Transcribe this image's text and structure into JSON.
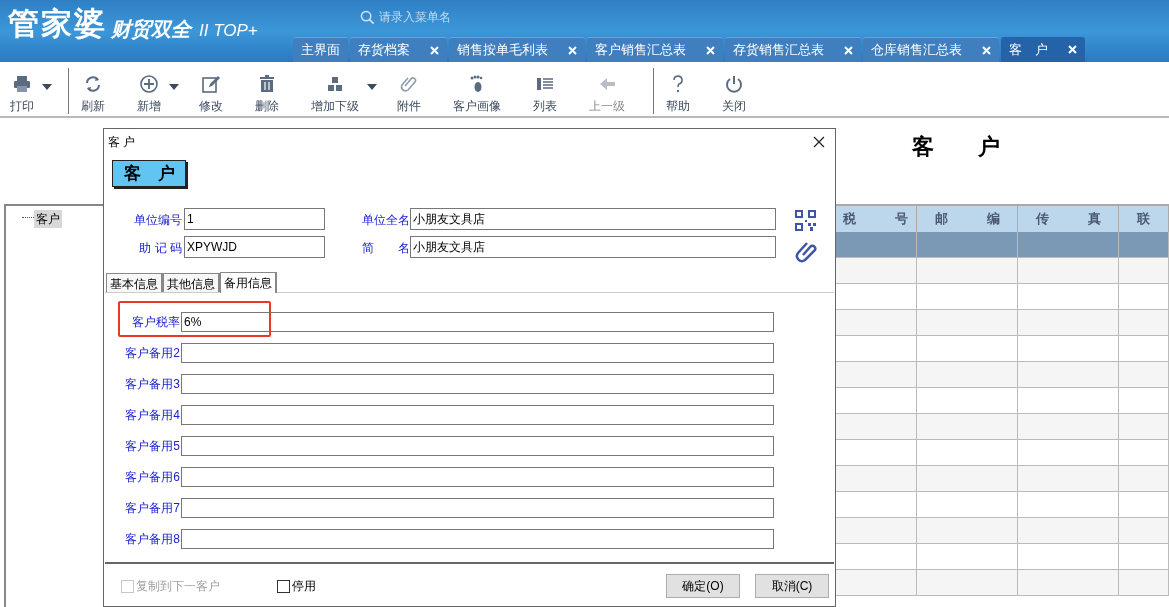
{
  "header": {
    "logo": "管家婆",
    "subtitle": "财贸双全",
    "edition": "II TOP+",
    "search": {
      "placeholder": "请录入菜单名"
    }
  },
  "tabs": [
    {
      "label": "主界面",
      "closable": false,
      "selected": false
    },
    {
      "label": "存货档案",
      "closable": true,
      "selected": false
    },
    {
      "label": "销售按单毛利表",
      "closable": true,
      "selected": false
    },
    {
      "label": "客户销售汇总表",
      "closable": true,
      "selected": false
    },
    {
      "label": "存货销售汇总表",
      "closable": true,
      "selected": false
    },
    {
      "label": "仓库销售汇总表",
      "closable": true,
      "selected": false
    },
    {
      "label": "客　户",
      "closable": true,
      "selected": true
    }
  ],
  "toolbar": [
    {
      "kind": "printer",
      "label": "打印",
      "dropdown": true,
      "disabled": false,
      "separator_after": true
    },
    {
      "kind": "refresh",
      "label": "刷新",
      "dropdown": false,
      "disabled": false,
      "separator_after": false
    },
    {
      "kind": "add",
      "label": "新增",
      "dropdown": true,
      "disabled": false,
      "separator_after": false
    },
    {
      "kind": "edit",
      "label": "修改",
      "dropdown": false,
      "disabled": false,
      "separator_after": false
    },
    {
      "kind": "delete",
      "label": "删除",
      "dropdown": false,
      "disabled": false,
      "separator_after": false
    },
    {
      "kind": "blocks",
      "label": "增加下级",
      "dropdown": true,
      "disabled": false,
      "separator_after": false
    },
    {
      "kind": "clip",
      "label": "附件",
      "dropdown": false,
      "disabled": false,
      "separator_after": false
    },
    {
      "kind": "foot",
      "label": "客户画像",
      "dropdown": false,
      "disabled": false,
      "separator_after": false
    },
    {
      "kind": "list",
      "label": "列表",
      "dropdown": false,
      "disabled": false,
      "separator_after": false
    },
    {
      "kind": "back",
      "label": "上一级",
      "dropdown": false,
      "disabled": true,
      "separator_after": true
    },
    {
      "kind": "help",
      "label": "帮助",
      "dropdown": false,
      "disabled": false,
      "separator_after": false
    },
    {
      "kind": "power",
      "label": "关闭",
      "dropdown": false,
      "disabled": false,
      "separator_after": false
    }
  ],
  "page_title": "客　　户",
  "tree": {
    "items": [
      {
        "label": "客户",
        "selected": true
      }
    ]
  },
  "grid": {
    "columns": [
      "税　　　号",
      "邮　　　编",
      "传　　　真",
      "联"
    ]
  },
  "dialog": {
    "title": "客 户",
    "banner": "客　户",
    "fields": [
      {
        "label": "单位编号",
        "value": "1"
      },
      {
        "label": "单位全名",
        "value": "小朋友文具店"
      },
      {
        "label": "助 记 码",
        "value": "XPYWJD"
      },
      {
        "label": "简　　名",
        "value": "小朋友文具店"
      }
    ],
    "tabs": [
      {
        "label": "基本信息",
        "selected": false
      },
      {
        "label": "其他信息",
        "selected": false
      },
      {
        "label": "备用信息",
        "selected": true
      }
    ],
    "extra_fields": [
      {
        "label": "客户税率",
        "value": "6%",
        "highlighted": true
      },
      {
        "label": "客户备用2",
        "highlighted": false
      },
      {
        "label": "客户备用3",
        "highlighted": false
      },
      {
        "label": "客户备用4",
        "highlighted": false
      },
      {
        "label": "客户备用5",
        "highlighted": false
      },
      {
        "label": "客户备用6",
        "highlighted": false
      },
      {
        "label": "客户备用7",
        "highlighted": false
      },
      {
        "label": "客户备用8",
        "highlighted": false
      }
    ],
    "checkboxes": [
      {
        "label": "复制到下一客户",
        "checked": false,
        "disabled": true
      },
      {
        "label": "停用",
        "checked": false,
        "disabled": false
      }
    ],
    "buttons": [
      "确定(O)",
      "取消(C)"
    ]
  }
}
